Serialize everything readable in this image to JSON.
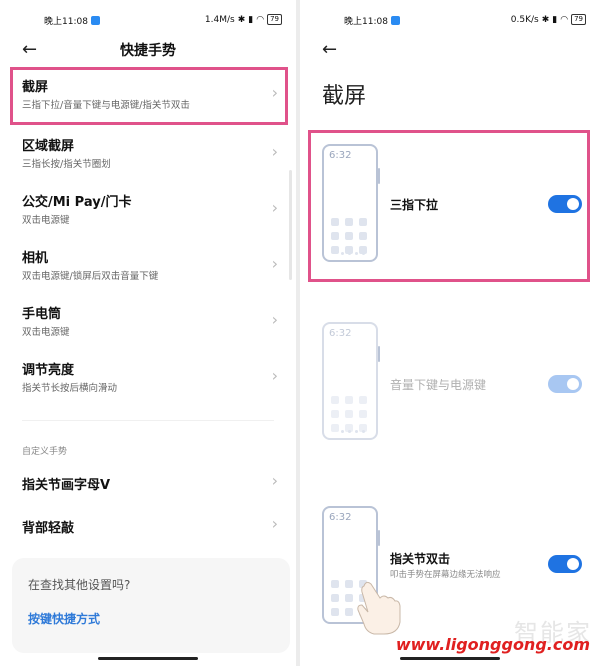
{
  "left": {
    "status": {
      "time": "晚上11:08",
      "net": "1.4M/s",
      "battery": "79"
    },
    "title": "快捷手势",
    "items": [
      {
        "title": "截屏",
        "subtitle": "三指下拉/音量下键与电源键/指关节双击"
      },
      {
        "title": "区域截屏",
        "subtitle": "三指长按/指关节圈划"
      },
      {
        "title": "公交/Mi Pay/门卡",
        "subtitle": "双击电源键"
      },
      {
        "title": "相机",
        "subtitle": "双击电源键/锁屏后双击音量下键"
      },
      {
        "title": "手电筒",
        "subtitle": "双击电源键"
      },
      {
        "title": "调节亮度",
        "subtitle": "指关节长按后横向滑动"
      }
    ],
    "section_label": "自定义手势",
    "custom_items": [
      {
        "title": "指关节画字母V"
      },
      {
        "title": "背部轻敲"
      }
    ],
    "card": {
      "question": "在查找其他设置吗?",
      "link": "按键快捷方式"
    }
  },
  "right": {
    "status": {
      "time": "晚上11:08",
      "net": "0.5K/s",
      "battery": "79"
    },
    "title": "截屏",
    "options": [
      {
        "label": "三指下拉",
        "clock": "6:32",
        "enabled": true,
        "on": true
      },
      {
        "label": "音量下键与电源键",
        "clock": "6:32",
        "enabled": false,
        "on": true
      },
      {
        "label": "指关节双击",
        "sub": "叩击手势在屏幕边缘无法响应",
        "clock": "6:32",
        "enabled": true,
        "on": true
      }
    ]
  },
  "watermark": {
    "text": "智能家",
    "url": "www.ligonggong.com"
  },
  "icons": {
    "back": "back-arrow-icon",
    "chevron": "chevron-right-icon",
    "hand": "hand-icon"
  },
  "colors": {
    "highlight": "#e0528a",
    "accent": "#1f73e2",
    "link": "#2f7ad8"
  }
}
